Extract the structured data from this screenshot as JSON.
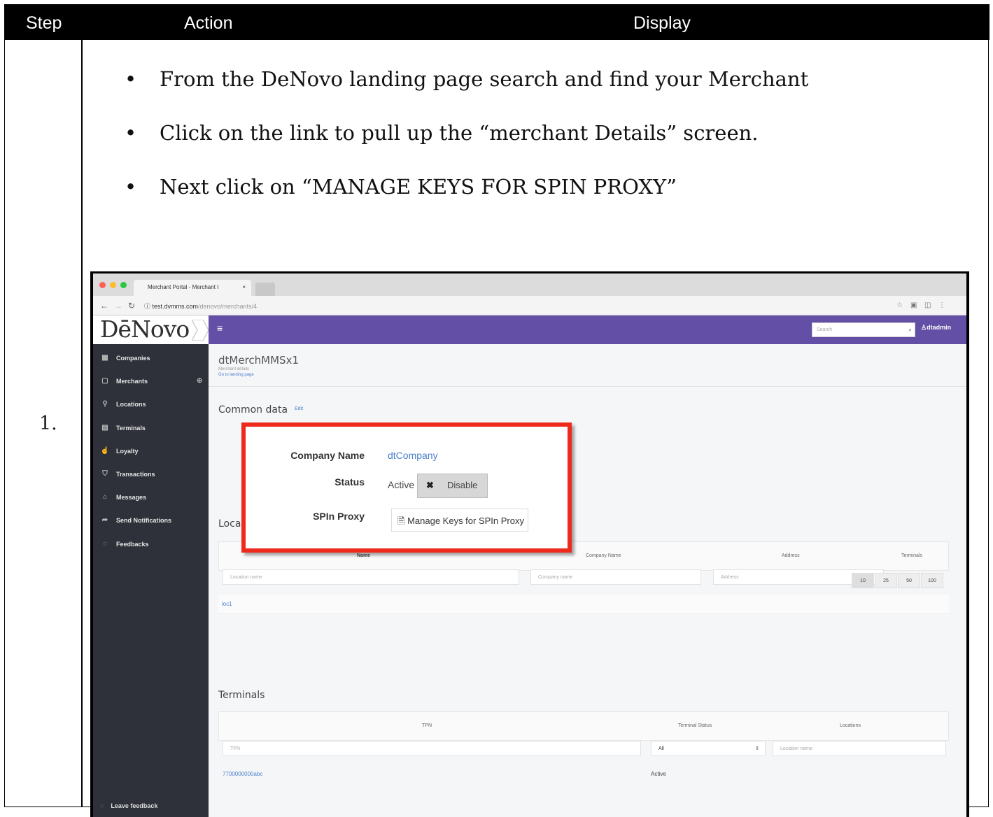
{
  "table": {
    "headers": {
      "step": "Step",
      "action": "Action",
      "display": "Display"
    },
    "step_number": "1.",
    "bullets": [
      "From the DeNovo landing page search and find your Merchant",
      "Click on the link to pull up the “merchant Details” screen.",
      "Next click on “MANAGE KEYS FOR SPIN PROXY”"
    ]
  },
  "browser": {
    "tab_title": "Merchant Portal - Merchant I",
    "tab_close": "×",
    "url_host": "test.dvmms.com",
    "url_path": "/denovo/merchants/4"
  },
  "app": {
    "logo": "DēNovo",
    "search_placeholder": "Search",
    "user": "dtadmin",
    "sidebar": [
      {
        "icon": "grid-icon",
        "label": "Companies"
      },
      {
        "icon": "box-icon",
        "label": "Merchants"
      },
      {
        "icon": "pin-icon",
        "label": "Locations"
      },
      {
        "icon": "terminal-icon",
        "label": "Terminals"
      },
      {
        "icon": "thumbs-up-icon",
        "label": "Loyalty"
      },
      {
        "icon": "shield-icon",
        "label": "Transactions"
      },
      {
        "icon": "inbox-icon",
        "label": "Messages"
      },
      {
        "icon": "send-icon",
        "label": "Send Notifications"
      },
      {
        "icon": "comment-icon",
        "label": "Feedbacks"
      }
    ],
    "leave_feedback": "Leave feedback",
    "merchant_title": "dtMerchMMSx1",
    "merchant_sub": "Merchant details",
    "merchant_link": "Go to landing page",
    "common_data": "Common data",
    "edit": "Edit",
    "locations_title": "Loca",
    "locations_table": {
      "headers": [
        "Name",
        "Company Name",
        "Address",
        "Terminals"
      ],
      "filters": [
        "Location name",
        "Company name",
        "Address"
      ],
      "row_link": "loc1"
    },
    "pager": [
      "10",
      "25",
      "50",
      "100"
    ],
    "terminals_title": "Terminals",
    "terminals_table": {
      "headers": [
        "TPN",
        "Terminal Status",
        "Locations"
      ],
      "filters": [
        "TPN",
        "All",
        "Location name"
      ],
      "row_tpn": "7700000000abc",
      "row_status": "Active"
    },
    "popup": {
      "company_label": "Company Name",
      "company_value": "dtCompany",
      "status_label": "Status",
      "status_value": "Active",
      "disable_label": "Disable",
      "spin_label": "SPIn Proxy",
      "manage_label": "Manage Keys for SPIn Proxy"
    }
  },
  "colors": {
    "highlight": "#ee2a1d",
    "topbar": "#6350a6",
    "sidebar": "#2e3139",
    "link": "#4a7fc9"
  }
}
